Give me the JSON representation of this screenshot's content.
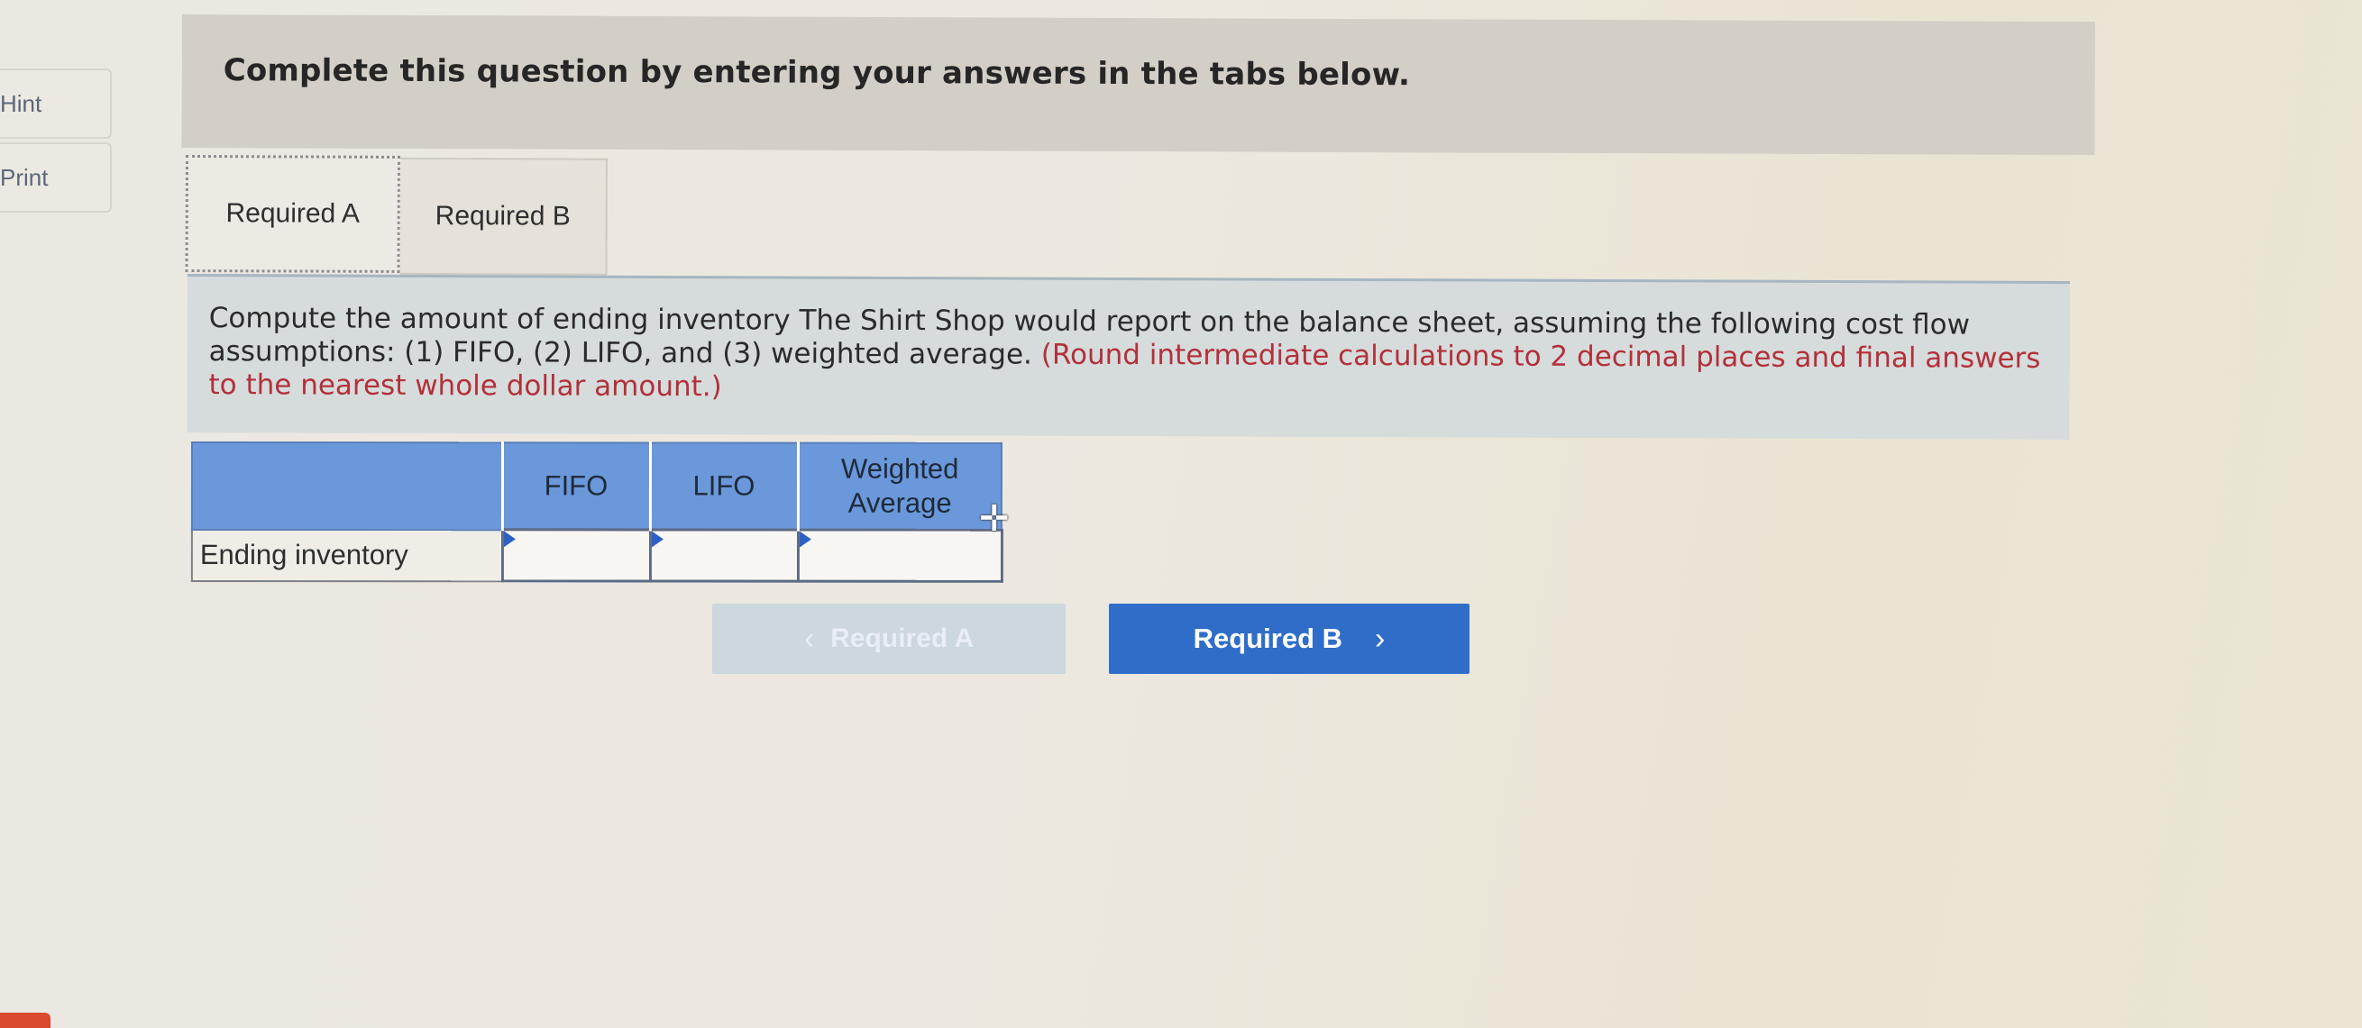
{
  "sidebar": {
    "hint_label": "Hint",
    "print_label": "Print"
  },
  "banner": {
    "text": "Complete this question by entering your answers in the tabs below."
  },
  "tabs": [
    {
      "label": "Required A",
      "active": true
    },
    {
      "label": "Required B",
      "active": false
    }
  ],
  "question": {
    "main_text": "Compute the amount of ending inventory The Shirt Shop would report on the balance sheet, assuming the following cost flow assumptions: (1) FIFO, (2) LIFO, and (3) weighted average.",
    "note_text": "(Round intermediate calculations to 2 decimal places and final answers to the nearest whole dollar amount.)"
  },
  "table": {
    "headers": [
      "",
      "FIFO",
      "LIFO",
      "Weighted Average"
    ],
    "rows": [
      {
        "label": "Ending inventory",
        "values": [
          "",
          "",
          ""
        ]
      }
    ]
  },
  "nav": {
    "prev_label": "Required A",
    "prev_enabled": false,
    "next_label": "Required B"
  },
  "colors": {
    "header_blue": "#6a98da",
    "next_button": "#2f6dc9",
    "note_red": "#b3303a"
  },
  "icons": {
    "prev": "chevron-left-icon",
    "next": "chevron-right-icon",
    "cursor": "plus-cursor-icon"
  }
}
